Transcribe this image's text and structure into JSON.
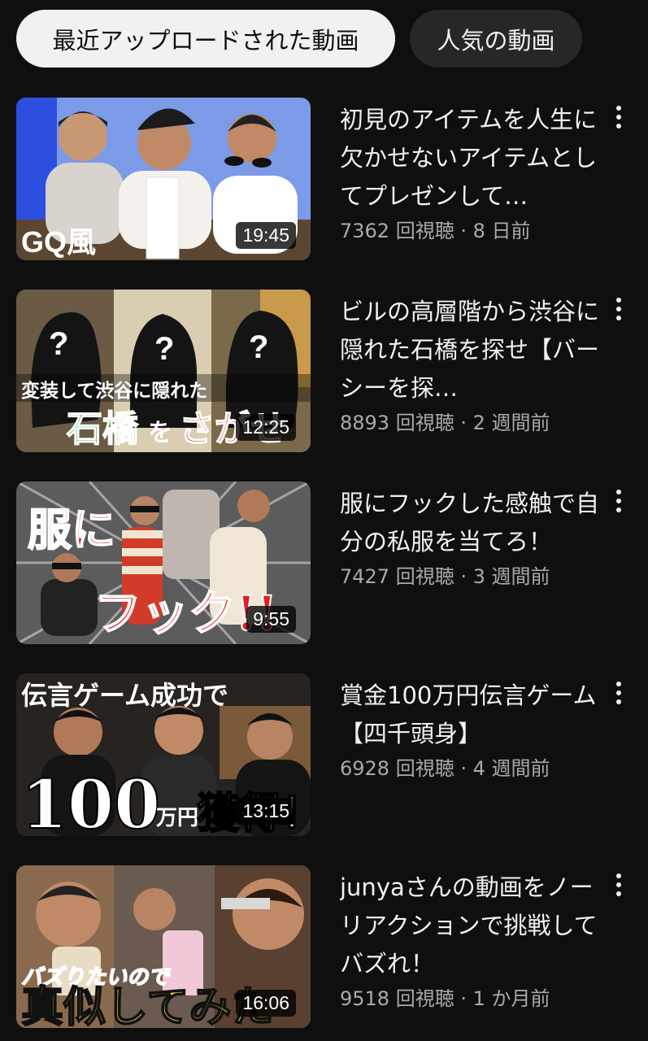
{
  "chips": [
    {
      "label": "最近アップロードされた動画",
      "active": true
    },
    {
      "label": "人気の動画",
      "active": false
    }
  ],
  "videos": [
    {
      "title": "初見のアイテムを人生に欠かせないアイテムとしてプレゼンして…",
      "views": "7362 回視聴",
      "age": "8 日前",
      "duration": "19:45",
      "thumb_text": "GQ風",
      "thumb_colors": [
        "#6f8fdf",
        "#efe8d8",
        "#3a2a22"
      ]
    },
    {
      "title": "ビルの高層階から渋谷に隠れた石橋を探せ【バーシーを探…",
      "views": "8893 回視聴",
      "age": "2 週間前",
      "duration": "12:25",
      "thumb_text_top": "変装して渋谷に隠れた",
      "thumb_text_green": "石橋",
      "thumb_text_white": "を",
      "thumb_text_red": "さがせ",
      "thumb_colors": [
        "#4a3b2a",
        "#1b1b1b",
        "#1f8f2f",
        "#d81a1a"
      ]
    },
    {
      "title": "服にフックした感触で自分の私服を当てろ！",
      "views": "7427 回視聴",
      "age": "3 週間前",
      "duration": "9:55",
      "thumb_text_1": "服に",
      "thumb_text_2": "フック!!",
      "thumb_colors": [
        "#6a6a6a",
        "#e21f1f",
        "#ffffff"
      ]
    },
    {
      "title": "賞金100万円伝言ゲーム【四千頭身】",
      "views": "6928 回視聴",
      "age": "4 週間前",
      "duration": "13:15",
      "thumb_text_top": "伝言ゲーム成功で",
      "thumb_text_big": "100",
      "thumb_text_unit": "万円",
      "thumb_text_end": "獲得！？",
      "thumb_colors": [
        "#1a1a1a",
        "#ffffff"
      ]
    },
    {
      "title": "junyaさんの動画をノーリアクションで挑戦してバズれ！",
      "views": "9518 回視聴",
      "age": "1 か月前",
      "duration": "16:06",
      "thumb_text_red": "バズりたいので",
      "thumb_text_yellow": "真似してみた",
      "thumb_colors": [
        "#8a6a4a",
        "#e21f1f",
        "#ffe23a"
      ]
    }
  ]
}
